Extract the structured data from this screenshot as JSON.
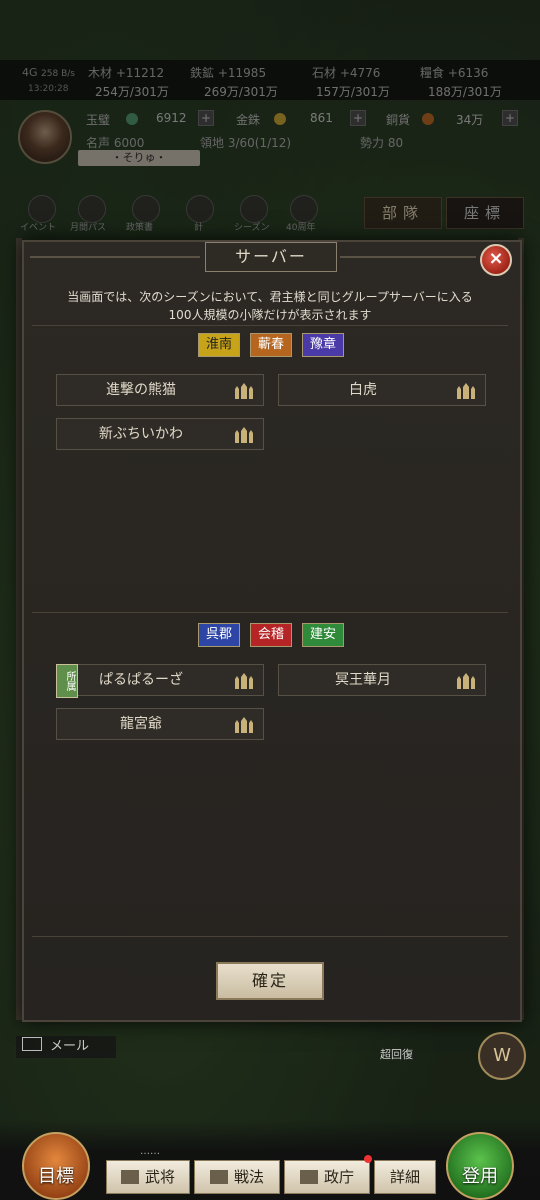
{
  "status": {
    "network": "4G",
    "speed": "258 B/s",
    "time": "13:20:28"
  },
  "resources": [
    {
      "name": "木材",
      "delta": "+11212",
      "amount": "254万/301万"
    },
    {
      "name": "鉄鉱",
      "delta": "+11985",
      "amount": "269万/301万"
    },
    {
      "name": "石材",
      "delta": "+4776",
      "amount": "157万/301万"
    },
    {
      "name": "糧食",
      "delta": "+6136",
      "amount": "188万/301万"
    }
  ],
  "currencies": [
    {
      "name": "玉璧",
      "value": "6912"
    },
    {
      "name": "金銖",
      "value": "861"
    },
    {
      "name": "銅貨",
      "value": "34万"
    }
  ],
  "player": {
    "name": "・そりゅ・",
    "fame": "名声 6000",
    "territory": "領地 3/60(1/12)",
    "power": "勢力 80"
  },
  "top_icons": [
    "イベント",
    "月間パス",
    "政策書",
    "計",
    "シーズン",
    "40周年"
  ],
  "side_tabs": {
    "troops": "部隊",
    "coords": "座標"
  },
  "dialog": {
    "title": "サーバー",
    "description_line1": "当画面では、次のシーズンにおいて、君主様と同じグループサーバーに入る",
    "description_line2": "100人規模の小隊だけが表示されます",
    "group1": {
      "banners": [
        "淮南",
        "蘄春",
        "豫章"
      ],
      "squads": [
        "進撃の熊猫",
        "白虎",
        "新ぶちいかわ"
      ]
    },
    "group2": {
      "banners": [
        "呉郡",
        "会稽",
        "建安"
      ],
      "squads": [
        "ぱるぱるーざ",
        "冥王華月",
        "龍宮爺"
      ],
      "flag": "所属"
    },
    "confirm": "確定"
  },
  "bottom": {
    "mail": "メール",
    "recover": "超回復",
    "goal": "目標",
    "enlist": "登用",
    "menu": [
      "武将",
      "戦法",
      "政庁",
      "詳細"
    ]
  },
  "colors": {
    "banner_yellow": "#c7a319",
    "banner_orange": "#b5651e",
    "banner_purple": "#4a3aa8",
    "banner_blue": "#2d45a5",
    "banner_red": "#b52525",
    "banner_green": "#2f8a3a"
  }
}
